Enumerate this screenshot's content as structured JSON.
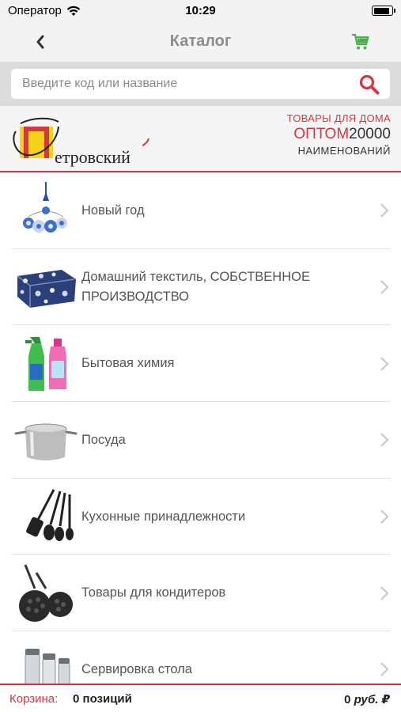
{
  "status_bar": {
    "carrier": "Оператор",
    "time": "10:29",
    "battery_level": 0.9
  },
  "nav": {
    "title": "Каталог",
    "back_icon": "chevron-left-icon",
    "cart_icon": "cart-icon",
    "accent_color": "#4caf50"
  },
  "search": {
    "placeholder": "Введите код или название",
    "value": "",
    "icon": "search-icon",
    "icon_color": "#d6363d"
  },
  "banner": {
    "logo_text": "етровский",
    "logo_letter": "П",
    "promo_line1": "ТОВАРЫ ДЛЯ ДОМА",
    "promo_opt": "ОПТОМ",
    "promo_number": "20000",
    "promo_line3": "НАИМЕНОВАНИЙ",
    "brand_color": "#d6363d"
  },
  "catalog": {
    "items": [
      {
        "label": "Новый год",
        "icon": "christmas-ornaments-icon"
      },
      {
        "label": "Домашний текстиль, СОБСТВЕННОЕ ПРОИЗВОДСТВО",
        "icon": "bedding-icon"
      },
      {
        "label": "Бытовая химия",
        "icon": "cleaning-bottles-icon"
      },
      {
        "label": "Посуда",
        "icon": "stock-pot-icon"
      },
      {
        "label": "Кухонные принадлежности",
        "icon": "kitchen-utensils-icon"
      },
      {
        "label": "Товары для кондитеров",
        "icon": "baking-pan-icon"
      },
      {
        "label": "Сервировка стола",
        "icon": "glassware-icon"
      }
    ]
  },
  "bottom_bar": {
    "cart_label": "Корзина:",
    "cart_count": "0 позиций",
    "total_value": "0",
    "total_currency": "руб. ₽"
  }
}
